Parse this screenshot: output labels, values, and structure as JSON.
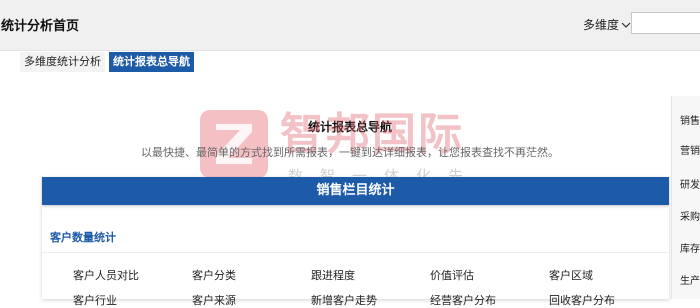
{
  "header": {
    "title": "统计分析首页",
    "dimension_label": "多维度",
    "search_value": ""
  },
  "tabs": [
    "多维度统计分析",
    "统计报表总导航"
  ],
  "main": {
    "heading": "统计报表总导航",
    "subheading": "以最快捷、最简单的方式找到所需报表，一键到达详细报表，让您报表查找不再茫然。",
    "panel_title": "销售栏目统计",
    "section_title": "客户数量统计",
    "row1": [
      "客户人员对比",
      "客户分类",
      "跟进程度",
      "价值评估",
      "客户区域"
    ],
    "row2": [
      "客户行业",
      "客户来源",
      "新增客户走势",
      "经营客户分布",
      "回收客户分布"
    ]
  },
  "sidebar": {
    "items": [
      "销售",
      "营销",
      "研发",
      "采购",
      "库存",
      "生产"
    ]
  },
  "watermark": {
    "brand": "智邦国际",
    "tagline": "数智一体化先行者"
  },
  "colors": {
    "accent": "#1d5aa8",
    "watermark": "#e05a64"
  }
}
